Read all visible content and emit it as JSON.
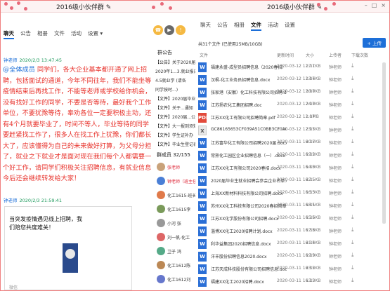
{
  "left_window": {
    "title": "2016级小伙伴群 ✎",
    "tabs": [
      "聊天",
      "公告",
      "相册",
      "文件",
      "活动",
      "设置 ▾"
    ],
    "active_tab": 0
  },
  "right_window": {
    "title": "2016级小伙伴群 ✎",
    "tabs": [
      "聊天",
      "公告",
      "相册",
      "文件",
      "活动",
      "设置"
    ],
    "active_tab": 3,
    "file_bar": "共31个文件 (已使用25MB/10GB)",
    "upload_label": "+ 上传",
    "headers": [
      "文件",
      "更新时间",
      "大小",
      "上传者",
      "下载次数"
    ]
  },
  "chat": {
    "msg1_name": "钟老师",
    "msg1_meta": "2020/2/3 13:47:45",
    "msg1_at": "@全体成员",
    "msg1_text": " 同学们，各大企业基本都开通了网上招聘，包括面试的通道，今年不同往年，我们不能坐等疫情结束后再找工作，不能等老师或学校给你机会，没有找好工作的同学，不要是否等待，最好我个工作单位，不要犹豫等待，奉劝各位一定要积极主动，还有4个月就要毕业了，时间不等人，毕业等待的同学要赶紧找工作了，很多人在找工作上犹豫，你们都长大了，应该懂得为自己的未来做好打算，为父母分担了，就业之下就业才是面对现在我们每个人都需要一个好工作，请同学们积极关注招聘信息，有就业信息今后还会继续转发给大家！",
    "msg2_name": "钟老师",
    "msg2_meta": "2020/2/3 21:59:41",
    "card_title": "当突发疫情遇见线上招聘，我们陪您共度难关！",
    "card_foot": "微信"
  },
  "announcements": {
    "header": "群公告",
    "items": [
      {
        "tag": "【公告】",
        "text": "关于2020届"
      },
      {
        "tag": "",
        "text": "2020年1...3.就业报告"
      },
      {
        "tag": "",
        "text": "4.5就业学 (请各"
      },
      {
        "tag": "",
        "text": "同学按时...)"
      },
      {
        "tag": "【文件】",
        "text": "2020届毕业生"
      },
      {
        "tag": "【文件】",
        "text": "关于...通知"
      },
      {
        "tag": "【文件】",
        "text": "2020届...公告"
      },
      {
        "tag": "【文件】",
        "text": "大一报到须知"
      },
      {
        "tag": "【文件】",
        "text": "学生证补办"
      },
      {
        "tag": "【文件】",
        "text": "毕业生登记表"
      }
    ]
  },
  "members": {
    "header": "群成员 32/155",
    "list": [
      "张老师",
      "钟老师（班主任）",
      "化工1615-班长",
      "化工1615李",
      "小河 张",
      "刘一帆-化工",
      "卫子 鸿",
      "化工1612陈",
      "化工1612刘"
    ]
  },
  "files": [
    {
      "icon": "W",
      "name": "福建永盛-成型员招聘信息（2020春招）.docx",
      "date": "2020-03-12 12:07",
      "size": "17.1KB",
      "uploader": "钟老师"
    },
    {
      "icon": "W",
      "name": "汉枫-化工业务员招聘信息.docx",
      "date": "2020-03-12 12:07",
      "size": "13.6KB",
      "uploader": "钟老师"
    },
    {
      "icon": "W",
      "name": "张家港（安徽）化工科技有限公司招聘.doc",
      "date": "2020-03-12 12:07",
      "size": "30.0KB",
      "uploader": "钟老师"
    },
    {
      "icon": "W",
      "name": "江苏扬农化工集团招聘.doc",
      "date": "2020-03-12 12:07",
      "size": "24.0KB",
      "uploader": "钟老师"
    },
    {
      "icon": "PDF",
      "name": "江苏XX化工有限公司招聘简章.pdf",
      "date": "2020-03-12 12:07",
      "size": "1.1MB",
      "uploader": "钟老师"
    },
    {
      "icon": "X",
      "name": "GC86165653CF039A51C0BB3CF0A00C.xls",
      "date": "2020-03-12 12:07",
      "size": "23.5KB",
      "uploader": "钟老师"
    },
    {
      "icon": "W",
      "name": "江苏富华化工有限公司招聘2020届.docx",
      "date": "2020-03-11 16:35",
      "size": "20.7KB",
      "uploader": "钟老师"
    },
    {
      "icon": "W",
      "name": "常熟化工园区企业招聘信息（一）.docx",
      "date": "2020-03-11 16:35",
      "size": "19.2KB",
      "uploader": "钟老师"
    },
    {
      "icon": "W",
      "name": "江苏XX化工有限公司2020春招.docx",
      "date": "2020-03-11 16:35",
      "size": "14.0KB",
      "uploader": "钟老师"
    },
    {
      "icon": "W",
      "name": "2020届毕业生就业招聘会参会企业名单.doc",
      "date": "2020-03-11 16:35",
      "size": "22.5KB",
      "uploader": "钟老师"
    },
    {
      "icon": "W",
      "name": "上海XX新材料科技有限公司招聘.docx",
      "date": "2020-03-11 16:35",
      "size": "16.3KB",
      "uploader": "钟老师"
    },
    {
      "icon": "W",
      "name": "苏州XX化工科技有限公司2020春招简章.docx",
      "date": "2020-03-11 16:35",
      "size": "18.1KB",
      "uploader": "钟老师"
    },
    {
      "icon": "W",
      "name": "江苏XX化学股份有限公司招聘.docx",
      "date": "2020-03-11 16:35",
      "size": "15.6KB",
      "uploader": "钟老师"
    },
    {
      "icon": "W",
      "name": "淄博XX化工2020招聘计划.docx",
      "date": "2020-03-11 16:35",
      "size": "17.8KB",
      "uploader": "钟老师"
    },
    {
      "icon": "W",
      "name": "利华益集团2020招聘信息.docx",
      "date": "2020-03-11 16:35",
      "size": "21.4KB",
      "uploader": "钟老师"
    },
    {
      "icon": "W",
      "name": "洋丰股份招聘信息2020.docx",
      "date": "2020-03-11 16:35",
      "size": "19.9KB",
      "uploader": "钟老师"
    },
    {
      "icon": "W",
      "name": "江苏天成科技股份有限公司招聘信息.docx",
      "date": "2020-03-11 16:35",
      "size": "23.2KB",
      "uploader": "钟老师"
    },
    {
      "icon": "W",
      "name": "福建XX化工2020招聘.docx",
      "date": "2020-03-11 16:35",
      "size": "13.3KB",
      "uploader": "钟老师"
    }
  ]
}
